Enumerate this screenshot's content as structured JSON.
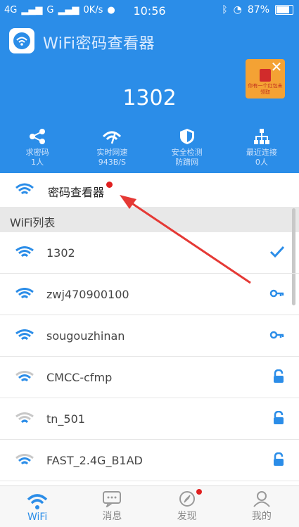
{
  "status_bar": {
    "network": "4G",
    "carrier2": "G",
    "speed": "0K/s",
    "time": "10:56",
    "battery": "87%"
  },
  "header": {
    "app_title": "WiFi密码查看器",
    "current_ssid": "1302",
    "ad_badge_text": "你有一个红包未领取",
    "stats": [
      {
        "label": "求密码",
        "value": "1人"
      },
      {
        "label": "实时网速",
        "value": "943B/S"
      },
      {
        "label": "安全检测",
        "value": "防蹭网"
      },
      {
        "label": "最近连接",
        "value": "0人"
      }
    ]
  },
  "finder": {
    "label": "密码查看器"
  },
  "wifi_list": {
    "section_title": "WiFi列表",
    "items": [
      {
        "ssid": "1302",
        "status": "connected"
      },
      {
        "ssid": "zwj470900100",
        "status": "key"
      },
      {
        "ssid": "sougouzhinan",
        "status": "key"
      },
      {
        "ssid": "CMCC-cfmp",
        "status": "locked"
      },
      {
        "ssid": "tn_501",
        "status": "locked"
      },
      {
        "ssid": "FAST_2.4G_B1AD",
        "status": "locked"
      }
    ]
  },
  "tabbar": {
    "tabs": [
      {
        "label": "WiFi",
        "active": true
      },
      {
        "label": "消息"
      },
      {
        "label": "发现"
      },
      {
        "label": "我的"
      }
    ]
  },
  "colors": {
    "accent": "#2b8de8",
    "badge_red": "#e02020",
    "arrow": "#e53935"
  }
}
